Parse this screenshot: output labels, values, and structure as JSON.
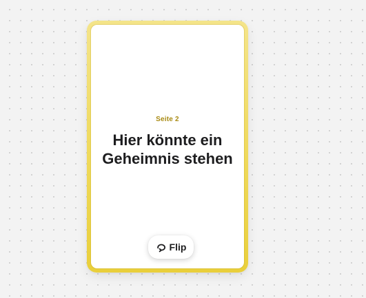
{
  "card": {
    "page_label": "Seite 2",
    "text": "Hier könnte ein Geheimnis stehen",
    "flip_label": "Flip",
    "flip_icon": "rotate-arrow-icon"
  },
  "colors": {
    "frame_yellow": "#efd95a",
    "label_gold": "#a88a12",
    "text_dark": "#1d1d1f",
    "canvas_bg": "#f3f3f3"
  }
}
